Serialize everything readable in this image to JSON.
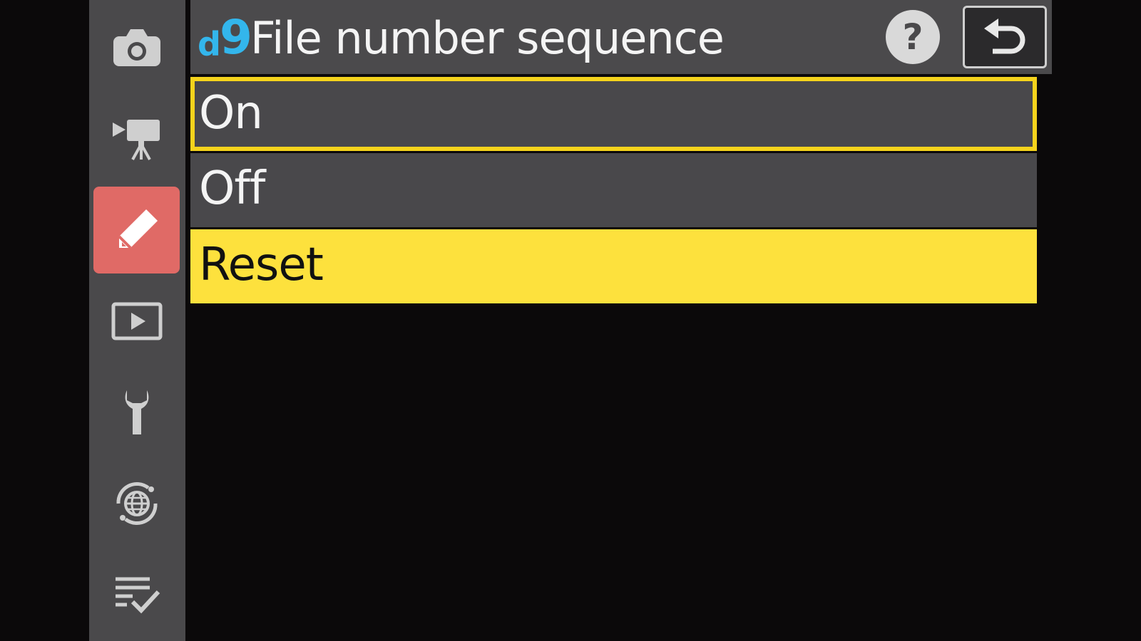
{
  "header": {
    "code_letter": "d",
    "code_number": "9",
    "title": "File number sequence",
    "help_label": "?"
  },
  "sidebar": {
    "items": [
      {
        "icon": "camera-icon",
        "active": false
      },
      {
        "icon": "movie-camera-icon",
        "active": false
      },
      {
        "icon": "pencil-icon",
        "active": true
      },
      {
        "icon": "playback-icon",
        "active": false
      },
      {
        "icon": "wrench-icon",
        "active": false
      },
      {
        "icon": "network-icon",
        "active": false
      },
      {
        "icon": "my-menu-icon",
        "active": false
      }
    ]
  },
  "options": [
    {
      "label": "On",
      "state": "focused"
    },
    {
      "label": "Off",
      "state": "normal"
    },
    {
      "label": "Reset",
      "state": "selected"
    }
  ],
  "colors": {
    "accent_blue": "#33b6ec",
    "highlight_yellow": "#fde13d",
    "focus_border": "#f5d31c",
    "active_tab": "#e06a66",
    "panel_gray": "#49484b"
  }
}
